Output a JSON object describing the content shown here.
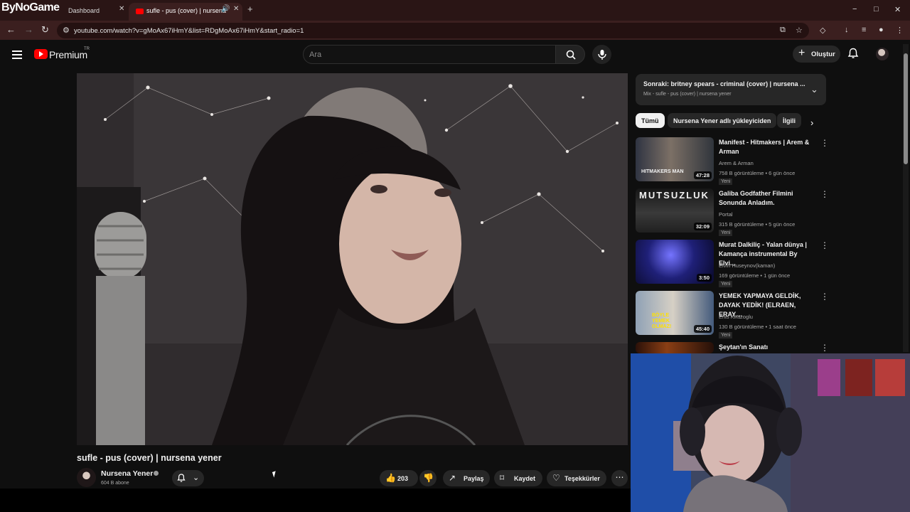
{
  "browser": {
    "logo": "ByNoGame",
    "tabs": [
      {
        "label": "Dashboard"
      },
      {
        "label": "sufle - pus (cover) | nursena"
      }
    ],
    "url": "youtube.com/watch?v=gMoAx67iHmY&list=RDgMoAx67iHmY&start_radio=1"
  },
  "youtube": {
    "brand": "Premium",
    "region": "TR",
    "search_placeholder": "Ara",
    "create_label": "Oluştur",
    "video": {
      "title": "sufle - pus (cover) | nursena yener",
      "channel": "Nursena Yener",
      "subscribers": "604 B abone",
      "likes": "203",
      "share": "Paylaş",
      "save": "Kaydet",
      "thanks": "Teşekkürler"
    },
    "next_up": {
      "title": "Sonraki: britney spears - criminal (cover) | nursena ...",
      "subtitle": "Mix - sufle - pus (cover) | nursena yener"
    },
    "chips": [
      "Tümü",
      "Nursena Yener adlı yükleyiciden",
      "İlgili"
    ],
    "recommendations": [
      {
        "title": "Manifest - Hitmakers | Arem & Arman",
        "channel": "Arem & Arman",
        "meta": "758 B görüntüleme • 6 gün önce",
        "badge": "Yeni",
        "duration": "47:28",
        "thumb_text": "HITMAKERS   MAN"
      },
      {
        "title": "Galiba Godfather Filmini Sonunda Anladım.",
        "channel": "Portal",
        "meta": "315 B görüntüleme • 5 gün önce",
        "badge": "Yeni",
        "duration": "32:09",
        "thumb_text": "MUTSUZLUK"
      },
      {
        "title": "Murat Dalkiliç - Yalan dünya | Kamança instrumental By Elvi...",
        "channel": "Elvin Huseynov(kaman)",
        "meta": "169 görüntüleme • 1 gün önce",
        "badge": "Yeni",
        "duration": "3:50",
        "thumb_text": ""
      },
      {
        "title": "YEMEK YAPMAYA GELDİK, DAYAK YEDİK! (ELRAEN, ERAY,...",
        "channel": "Enis Kirazoglu",
        "meta": "130 B görüntüleme • 1 saat önce",
        "badge": "Yeni",
        "duration": "45:40",
        "thumb_text": "BÖYLE YEMEK OLMAZ!"
      },
      {
        "title": "Şeytan'ın Sanatı",
        "channel": "",
        "meta": "",
        "badge": "",
        "duration": "",
        "thumb_text": ""
      }
    ]
  }
}
